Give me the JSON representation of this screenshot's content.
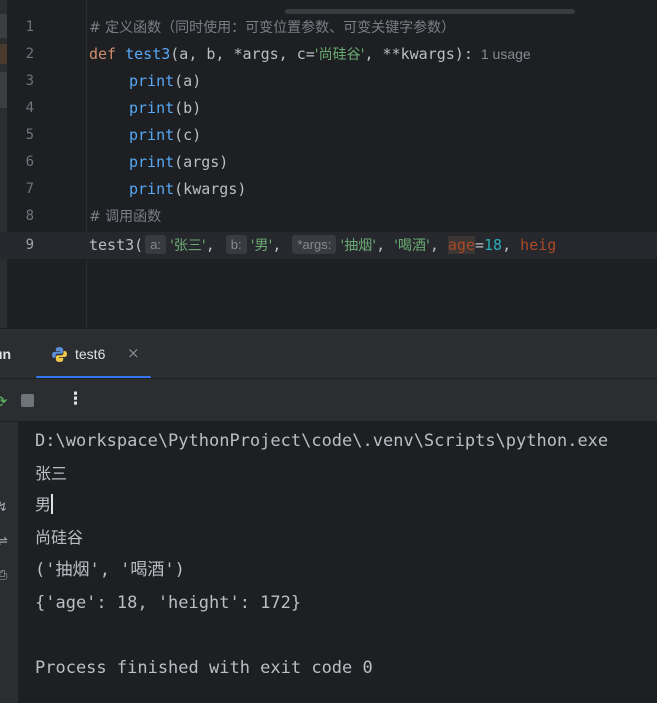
{
  "editor": {
    "lines": [
      {
        "number": "1",
        "comment": "# 定义函数（同时使用：可变位置参数、可变关键字参数）"
      },
      {
        "number": "2",
        "def_kw": "def",
        "func_name": "test3",
        "params_open": "(a, b, *args, c=",
        "default_str": "'尚硅谷'",
        "params_close": ", **kwargs):",
        "usage_hint": "1 usage"
      },
      {
        "number": "3",
        "call": "print",
        "arg": "(a)"
      },
      {
        "number": "4",
        "call": "print",
        "arg": "(b)"
      },
      {
        "number": "5",
        "call": "print",
        "arg": "(c)"
      },
      {
        "number": "6",
        "call": "print",
        "arg": "(args)"
      },
      {
        "number": "7",
        "call": "print",
        "arg": "(kwargs)"
      },
      {
        "number": "8",
        "comment": "# 调用函数"
      },
      {
        "number": "9",
        "func_call": "test3(",
        "hint_a": "a:",
        "arg_a": "'张三'",
        "sep1": ", ",
        "hint_b": "b:",
        "arg_b": "'男'",
        "sep2": ", ",
        "hint_args": "*args:",
        "arg_args1": "'抽烟'",
        "sep3": ", ",
        "arg_args2": "'喝酒'",
        "sep4": ", ",
        "kw_age": "age",
        "eq1": "=",
        "val_age": "18",
        "sep5": ", ",
        "kw_height_partial": "heig"
      }
    ]
  },
  "run_panel": {
    "title": "un",
    "tab": {
      "label": "test6",
      "close": "×"
    },
    "toolbar": {
      "rerun": "⟳",
      "more": "⋮"
    },
    "sidebar_icons": [
      "↯",
      "⇌",
      "⎙"
    ],
    "console": {
      "interpreter_path": "D:\\workspace\\PythonProject\\code\\.venv\\Scripts\\python.exe",
      "out_a": "张三",
      "out_b": "男",
      "out_c": "尚硅谷",
      "out_args": "('抽烟', '喝酒')",
      "out_kwargs": "{'age': 18, 'height': 172}",
      "exit_message": "Process finished with exit code 0"
    }
  },
  "colors": {
    "keyword": "#cf8e6d",
    "function": "#56a8f5",
    "string": "#6aab73",
    "number": "#2aacb8",
    "comment": "#7a7e85",
    "kwarg": "#aa4926",
    "accent": "#3574f0"
  }
}
